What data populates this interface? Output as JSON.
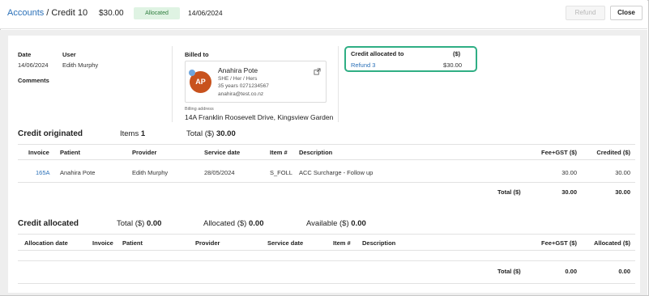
{
  "header": {
    "breadcrumb_root": "Accounts",
    "breadcrumb_sep": " / ",
    "breadcrumb_current": "Credit 10",
    "amount": "$30.00",
    "status": "Allocated",
    "date": "14/06/2024",
    "refund_label": "Refund",
    "close_label": "Close"
  },
  "details": {
    "date_label": "Date",
    "date_value": "14/06/2024",
    "user_label": "User",
    "user_value": "Edith Murphy",
    "comments_label": "Comments"
  },
  "billed_to": {
    "label": "Billed to",
    "initials": "AP",
    "name": "Anahira Pote",
    "pronouns": "SHE / Her / Hers",
    "age_phone": "35 years  0271234567",
    "email": "anahira@test.co.nz",
    "billing_address_label": "Billing address",
    "billing_address": "14A Franklin Roosevelt Drive, Kingsview Garden"
  },
  "credit_allocated_to": {
    "title": "Credit allocated to",
    "currency_header": "($)",
    "item_label": "Refund 3",
    "item_amount": "$30.00"
  },
  "credit_originated": {
    "title": "Credit originated",
    "items_label": "Items",
    "items_value": "1",
    "total_label": "Total ($)",
    "total_value": "30.00",
    "columns": [
      "Invoice",
      "Patient",
      "Provider",
      "Service date",
      "Item #",
      "Description",
      "Fee+GST ($)",
      "Credited ($)"
    ],
    "rows": [
      {
        "invoice": "165A",
        "patient": "Anahira Pote",
        "provider": "Edith Murphy",
        "service_date": "28/05/2024",
        "item": "S_FOLL",
        "description": "ACC Surcharge - Follow up",
        "fee": "30.00",
        "credited": "30.00"
      }
    ],
    "footer_label": "Total ($)",
    "footer_fee": "30.00",
    "footer_credited": "30.00"
  },
  "credit_allocated": {
    "title": "Credit allocated",
    "total_label": "Total ($)",
    "total_value": "0.00",
    "allocated_label": "Allocated ($)",
    "allocated_value": "0.00",
    "available_label": "Available ($)",
    "available_value": "0.00",
    "columns": [
      "Allocation date",
      "Invoice",
      "Patient",
      "Provider",
      "Service date",
      "Item #",
      "Description",
      "Fee+GST ($)",
      "Allocated ($)"
    ],
    "footer_label": "Total ($)",
    "footer_fee": "0.00",
    "footer_allocated": "0.00"
  },
  "colors": {
    "link": "#2a70b8",
    "badge_bg": "#dff3e3",
    "badge_text": "#2e7d3e",
    "highlight_border": "#2fae84",
    "avatar": "#c8521d"
  }
}
